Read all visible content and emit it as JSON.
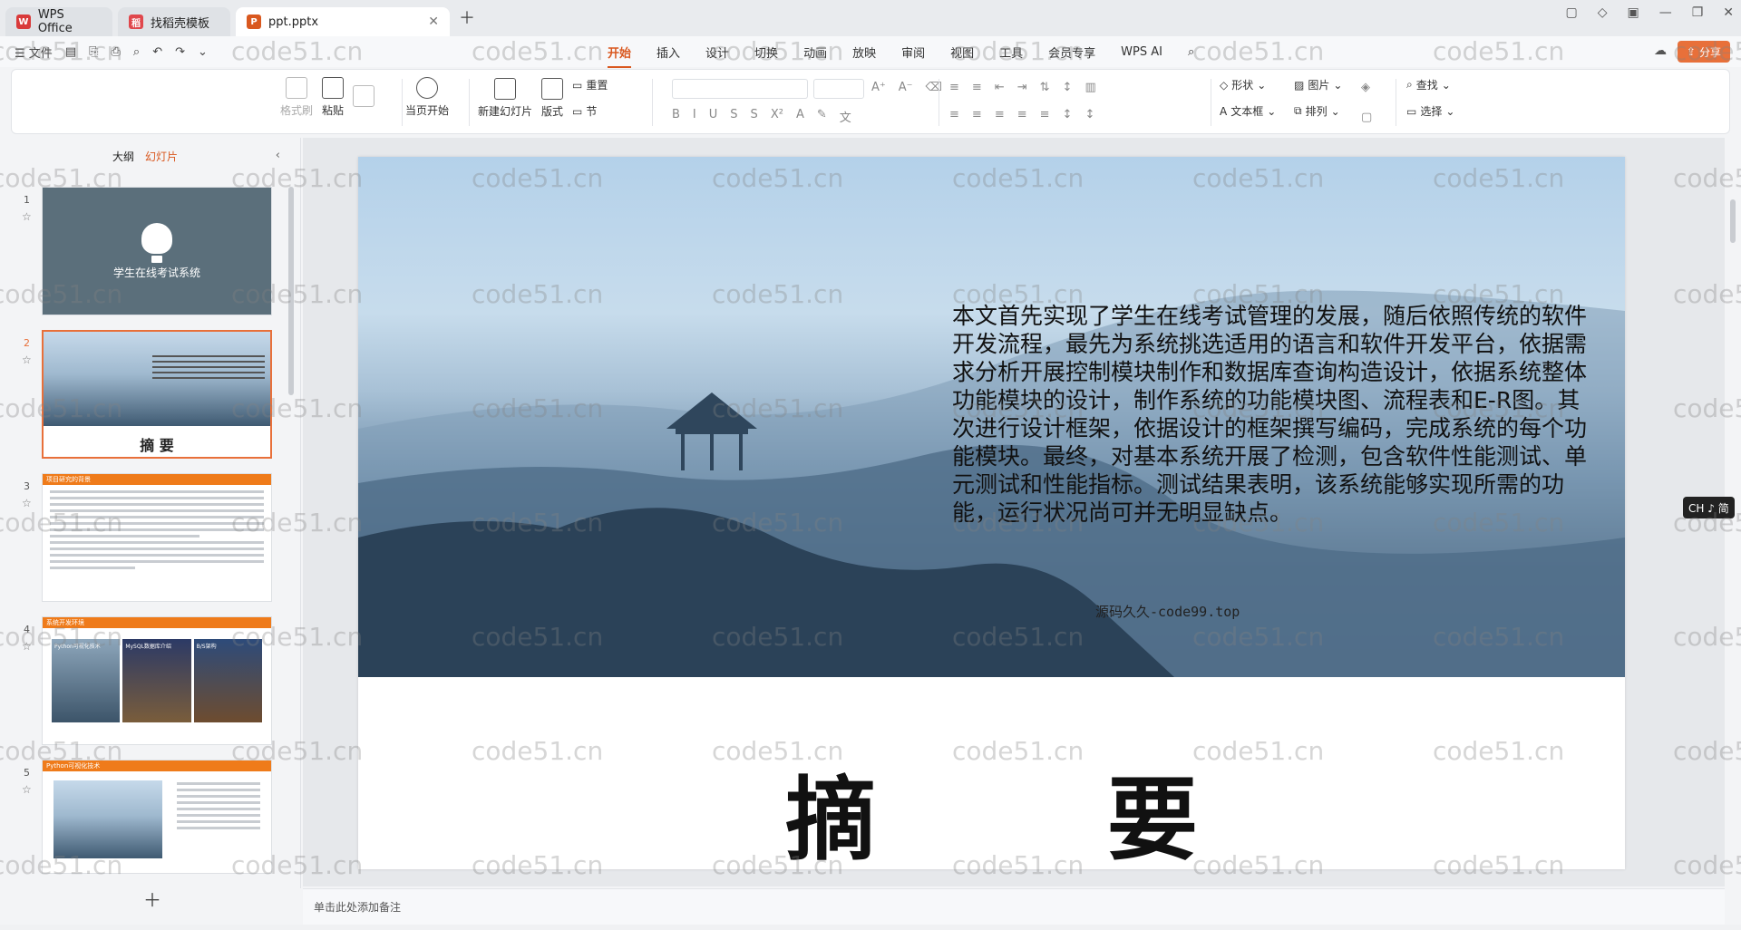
{
  "tabs": [
    {
      "label": "WPS Office",
      "icon": "wps-logo",
      "color": "#d93a3a"
    },
    {
      "label": "找稻壳模板",
      "icon": "template-icon",
      "color": "#e0474c"
    },
    {
      "label": "ppt.pptx",
      "icon": "ppt-file-icon",
      "color": "#d9581f"
    }
  ],
  "menu": {
    "file": "文件"
  },
  "ribbon_tabs": [
    "开始",
    "插入",
    "设计",
    "切换",
    "动画",
    "放映",
    "审阅",
    "视图",
    "工具",
    "会员专享",
    "WPS AI"
  ],
  "active_ribbon_tab": "开始",
  "share_label": "分享",
  "toolbar": {
    "format_painter": "格式刷",
    "paste": "粘贴",
    "play_from_current": "当页开始",
    "new_slide": "新建幻灯片",
    "layout": "版式",
    "reset": "重置",
    "section": "节",
    "shape": "形状",
    "picture": "图片",
    "find": "查找",
    "textbox": "文本框",
    "arrange": "排列",
    "select": "选择"
  },
  "left_panel": {
    "tab_outline": "大纲",
    "tab_slides": "幻灯片",
    "active_tab": "幻灯片",
    "slides": [
      {
        "num": "1",
        "title": "学生在线考试系统"
      },
      {
        "num": "2",
        "title": "摘 要"
      },
      {
        "num": "3",
        "title": "项目研究的背景"
      },
      {
        "num": "4",
        "title": "系统开发环境",
        "cards": [
          "Python可视化技术",
          "MySQL数据库介绍",
          "B/S架构"
        ]
      },
      {
        "num": "5",
        "title": "Python可视化技术"
      }
    ],
    "selected": "2"
  },
  "slide": {
    "abstract": "本文首先实现了学生在线考试管理的发展，随后依照传统的软件开发流程，最先为系统挑选适用的语言和软件开发平台，依据需求分析开展控制模块制作和数据库查询构造设计，依据系统整体功能模块的设计，制作系统的功能模块图、流程表和E-R图。其次进行设计框架，依据设计的框架撰写编码，完成系统的每个功能模块。最终，对基本系统开展了检测，包含软件性能测试、单元测试和性能指标。测试结果表明，该系统能够实现所需的功能，运行状况尚可并无明显缺点。",
    "title": "摘 要",
    "overlay": "源码久久-code99.top"
  },
  "notes_placeholder": "单击此处添加备注",
  "ime": "CH ♪ 简",
  "watermark": "code51.cn",
  "colors": {
    "accent": "#d9581f",
    "share": "#e8703a",
    "thumb_header": "#ef7b1a"
  }
}
